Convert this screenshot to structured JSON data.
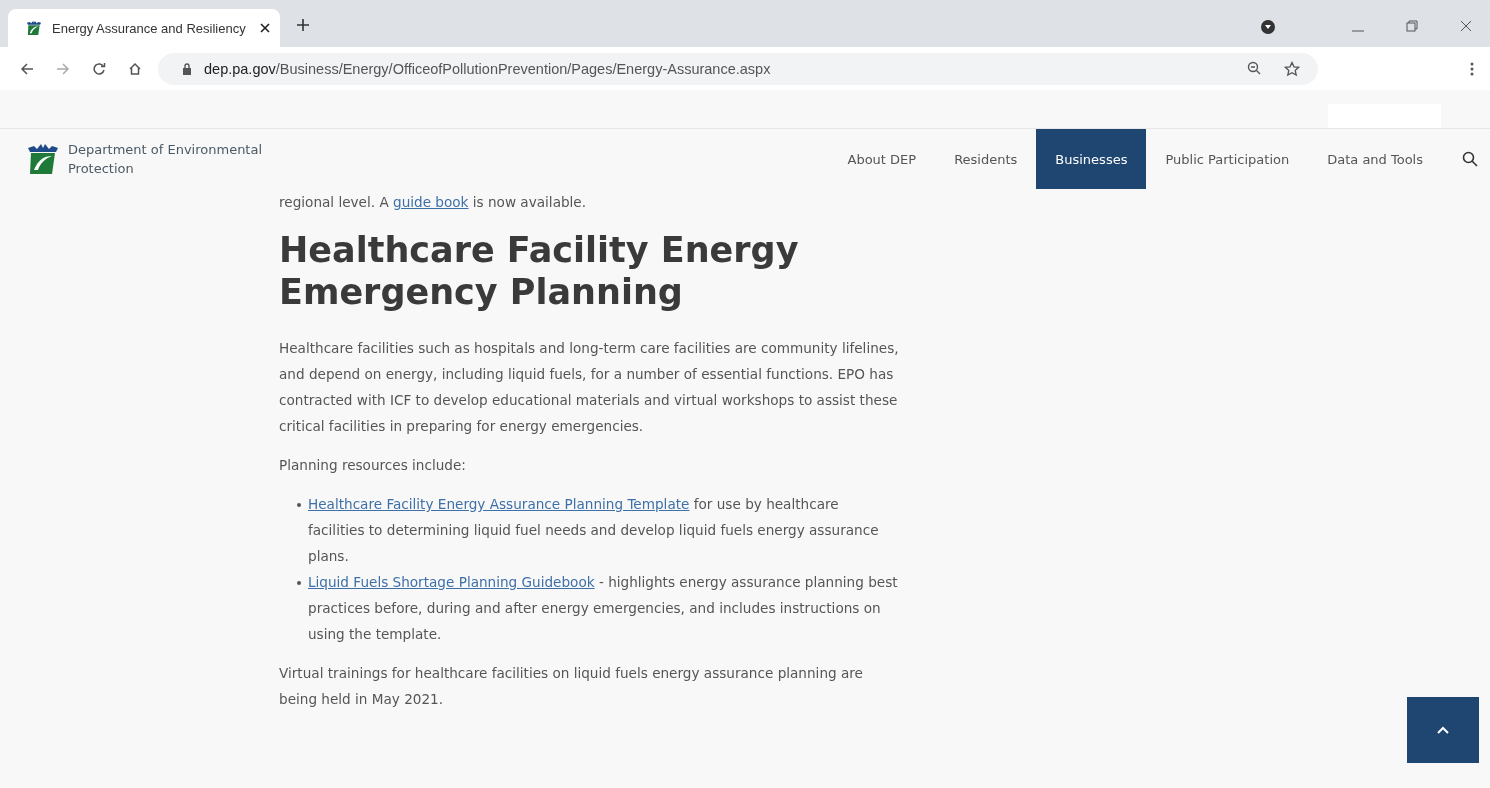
{
  "browser": {
    "tab": {
      "title": "Energy Assurance and Resiliency",
      "selected": true
    },
    "address": {
      "domain": "dep.pa.gov",
      "path": "/Business/Energy/OfficeofPollutionPrevention/Pages/Energy-Assurance.aspx"
    }
  },
  "site": {
    "logo_text": "Department of Environmental Protection",
    "nav": [
      {
        "label": "About DEP",
        "selected": false
      },
      {
        "label": "Residents",
        "selected": false
      },
      {
        "label": "Businesses",
        "selected": true
      },
      {
        "label": "Public Participation",
        "selected": false
      },
      {
        "label": "Data and Tools",
        "selected": false
      }
    ]
  },
  "content": {
    "blocks": [
      {
        "kind": "paragraph",
        "parts": [
          {
            "text": "regional level. A "
          },
          {
            "link": "guide book"
          },
          {
            "text": " is now available."
          }
        ]
      },
      {
        "kind": "heading",
        "text": "Healthcare Facility Energy Emergency Planning"
      },
      {
        "kind": "paragraph",
        "parts": [
          {
            "text": "Healthcare facilities such as hospitals and long-term care facilities are community lifelines, and depend on energy, including liquid fuels, for a number of essential functions.  EPO has contracted with ICF to develop educational materials and virtual workshops to assist these critical facilities in preparing for energy emergencies."
          }
        ]
      },
      {
        "kind": "paragraph",
        "parts": [
          {
            "text": "Planning resources include:"
          }
        ]
      },
      {
        "kind": "list",
        "items": [
          {
            "parts": [
              {
                "link": "Healthcare Facility Energy Assurance Planning Template"
              },
              {
                "text": " for use by healthcare facilities to determining liquid fuel needs and develop liquid fuels energy assurance plans."
              }
            ]
          },
          {
            "parts": [
              {
                "link": "Liquid Fuels Shortage Planning Guidebook"
              },
              {
                "text": " - highlights energy assurance planning best practices before, during and after energy emergencies, and includes instructions on using the template."
              }
            ]
          }
        ]
      },
      {
        "kind": "paragraph",
        "parts": [
          {
            "text": "Virtual trainings for healthcare facilities on liquid fuels energy assurance planning are being held in May 2021."
          }
        ]
      }
    ]
  }
}
